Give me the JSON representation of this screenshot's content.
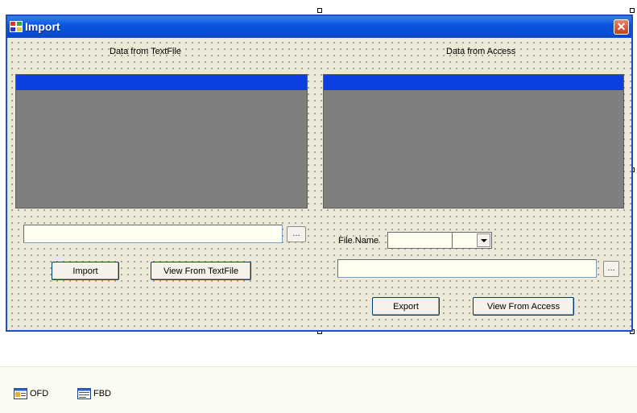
{
  "window": {
    "title": "Import",
    "close_glyph": "✕",
    "titlebar_color": "#0a55e0",
    "client_color": "#ece9d8"
  },
  "left_panel": {
    "caption": "Data from TextFile",
    "path_value": "",
    "browse_label": "...",
    "import_label": "Import",
    "view_label": "View From TextFile"
  },
  "right_panel": {
    "caption": "Data from Access",
    "file_name_label": "File Name",
    "file_name_value": "",
    "path_value": "",
    "browse_label": "...",
    "export_label": "Export",
    "view_label": "View From Access"
  },
  "component_tray": {
    "items": [
      {
        "label": "OFD",
        "icon": "open-file-dialog-icon"
      },
      {
        "label": "FBD",
        "icon": "folder-browser-dialog-icon"
      }
    ]
  },
  "colors": {
    "grid_background": "#7f7f7f",
    "grid_header": "#0a40e0",
    "textbox_background": "#fffff0"
  }
}
